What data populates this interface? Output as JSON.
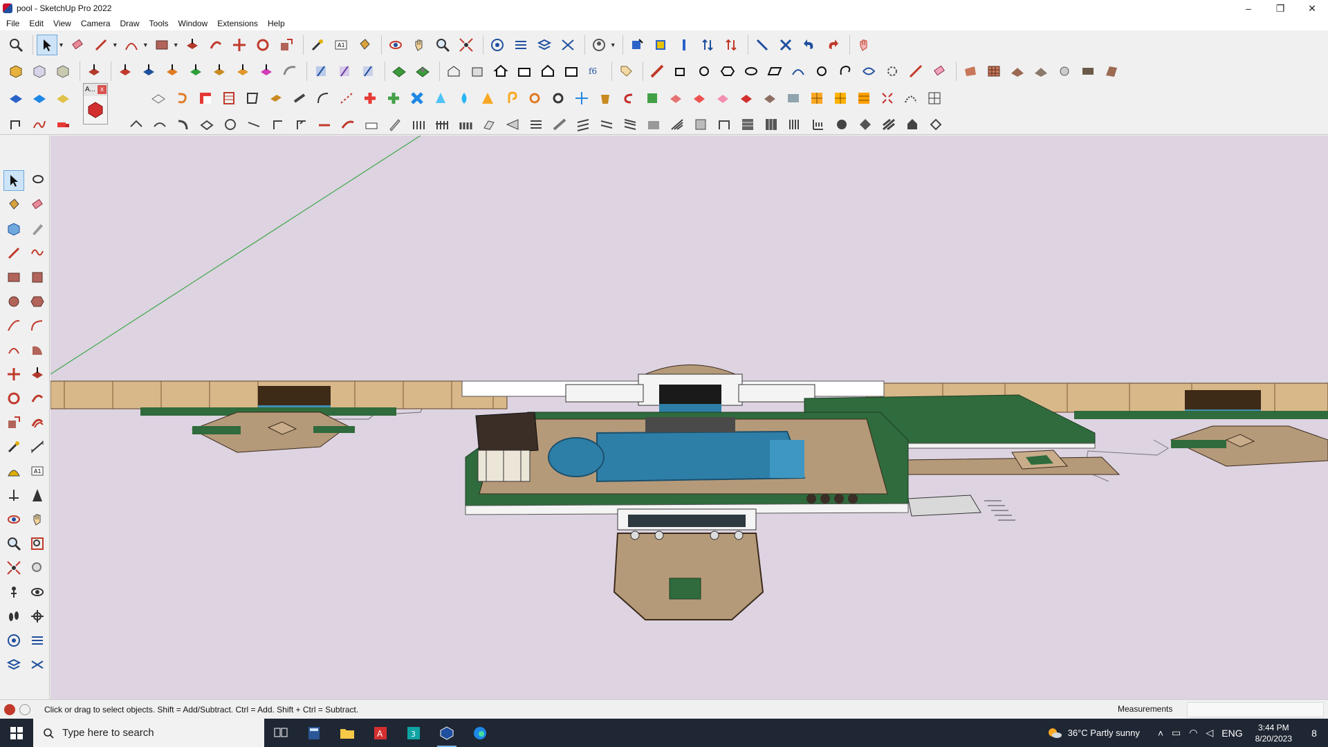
{
  "window": {
    "title": "pool - SketchUp Pro 2022",
    "controls": {
      "minimize": "–",
      "maximize": "❐",
      "close": "✕"
    }
  },
  "menu": [
    "File",
    "Edit",
    "View",
    "Camera",
    "Draw",
    "Tools",
    "Window",
    "Extensions",
    "Help"
  ],
  "floating_palette": {
    "title": "A...",
    "close": "x"
  },
  "status": {
    "hint": "Click or drag to select objects. Shift = Add/Subtract. Ctrl = Add. Shift + Ctrl = Subtract.",
    "measurements_label": "Measurements",
    "measurements_value": ""
  },
  "taskbar": {
    "search_placeholder": "Type here to search",
    "weather": "36°C  Partly sunny",
    "language": "ENG",
    "time": "3:44 PM",
    "date": "8/20/2023",
    "notifications": "8"
  },
  "colors": {
    "viewport_bg": "#ddd3e1",
    "pool_water": "#2e7fa8",
    "lawn": "#2f6b3c",
    "paving": "#b59a7a",
    "accent_selected": "#cde3f7"
  }
}
